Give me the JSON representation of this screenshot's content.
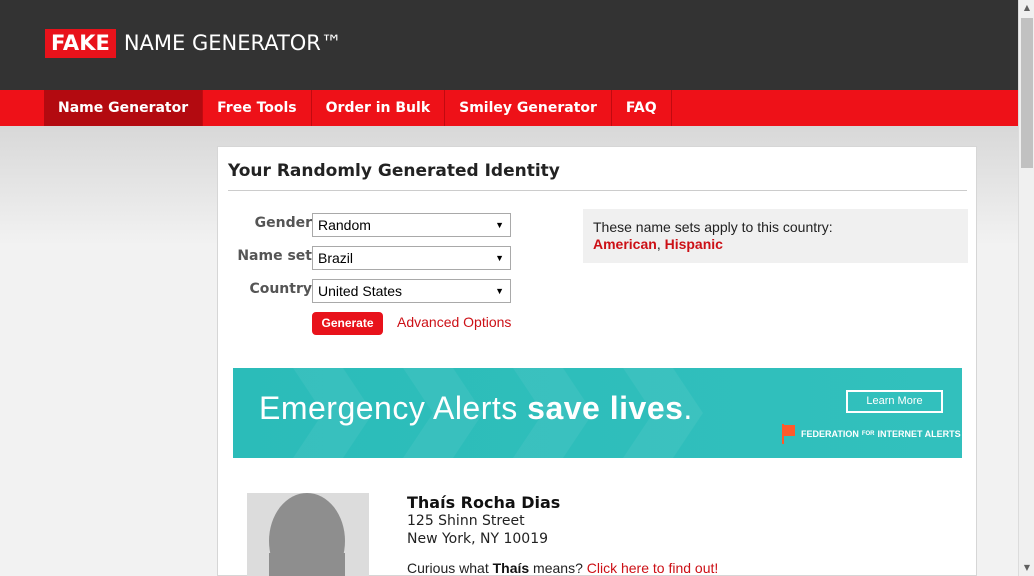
{
  "header": {
    "logo_fake": "FAKE",
    "logo_rest": "NAME GENERATOR™"
  },
  "nav": {
    "items": [
      {
        "label": "Name Generator",
        "active": true
      },
      {
        "label": "Free Tools",
        "active": false
      },
      {
        "label": "Order in Bulk",
        "active": false
      },
      {
        "label": "Smiley Generator",
        "active": false
      },
      {
        "label": "FAQ",
        "active": false
      }
    ]
  },
  "panel": {
    "title": "Your Randomly Generated Identity"
  },
  "form": {
    "gender_label": "Gender",
    "gender_value": "Random",
    "nameset_label": "Name set",
    "nameset_value": "Brazil",
    "country_label": "Country",
    "country_value": "United States",
    "generate_label": "Generate",
    "advanced_label": "Advanced Options"
  },
  "nameset_info": {
    "text": "These name sets apply to this country:",
    "links": [
      "American",
      "Hispanic"
    ],
    "separator": ", "
  },
  "ad": {
    "text_light": "Emergency Alerts ",
    "text_bold": "save lives",
    "text_end": ".",
    "button_label": "Learn More",
    "org_a": "FEDERATION",
    "org_b": "FOR",
    "org_c": "INTERNET ALERTS"
  },
  "identity": {
    "name": "Thaís Rocha Dias",
    "street": "125 Shinn Street",
    "city_line": "New York, NY 10019",
    "curious_prefix": "Curious what ",
    "curious_name": "Thaís",
    "curious_suffix": " means? ",
    "curious_link": "Click here to find out!"
  },
  "colors": {
    "brand_red": "#ee1118",
    "header_dark": "#333333",
    "ad_teal": "#2bbcb9"
  }
}
